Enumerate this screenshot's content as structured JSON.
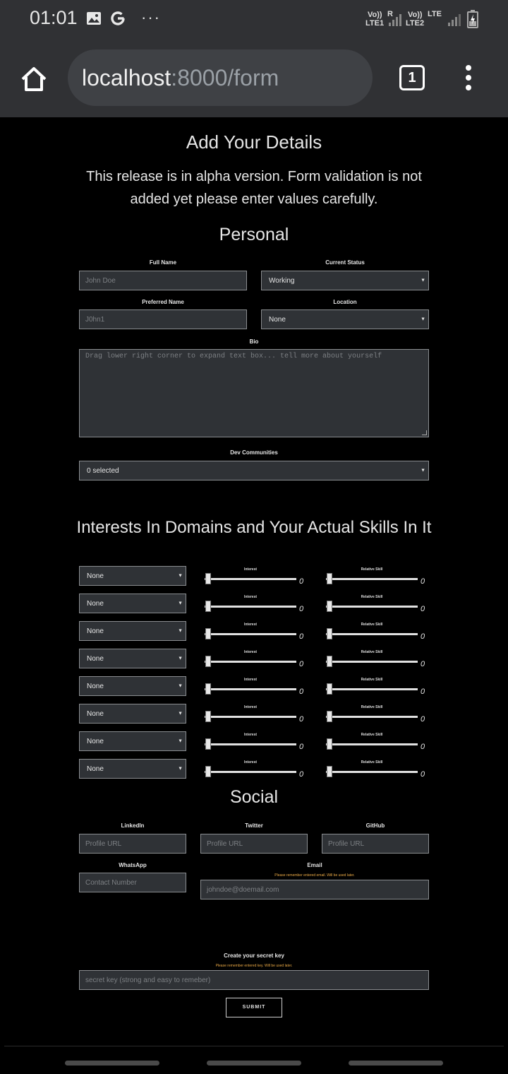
{
  "status_bar": {
    "time": "01:01",
    "icons": [
      "image-icon",
      "google-icon",
      "more-icon"
    ],
    "sim1": "LTE1",
    "sim2": "LTE2",
    "volte1": "Vo))",
    "volte2": "Vo))",
    "roaming": "R",
    "lte": "LTE"
  },
  "browser": {
    "url_host": "localhost",
    "url_path": ":8000/form",
    "tab_count": "1"
  },
  "page": {
    "title": "Add Your Details",
    "notice": "This release is in alpha version. Form validation is not added yet please enter values carefully."
  },
  "personal": {
    "heading": "Personal",
    "full_name_label": "Full Name",
    "full_name_placeholder": "John Doe",
    "current_status_label": "Current Status",
    "current_status_value": "Working",
    "preferred_name_label": "Preferred Name",
    "preferred_name_placeholder": "J0hn1",
    "location_label": "Location",
    "location_value": "None",
    "bio_label": "Bio",
    "bio_placeholder": "Drag lower right corner to expand text box... tell more about yourself",
    "dev_communities_label": "Dev Communities",
    "dev_communities_value": "0 selected"
  },
  "interests": {
    "heading": "Interests In Domains and Your Actual Skills In It",
    "interest_label": "Interest",
    "skill_label": "Relative Skill",
    "rows": [
      {
        "domain": "None",
        "interest": 0,
        "skill": 0
      },
      {
        "domain": "None",
        "interest": 0,
        "skill": 0
      },
      {
        "domain": "None",
        "interest": 0,
        "skill": 0
      },
      {
        "domain": "None",
        "interest": 0,
        "skill": 0
      },
      {
        "domain": "None",
        "interest": 0,
        "skill": 0
      },
      {
        "domain": "None",
        "interest": 0,
        "skill": 0
      },
      {
        "domain": "None",
        "interest": 0,
        "skill": 0
      },
      {
        "domain": "None",
        "interest": 0,
        "skill": 0
      }
    ]
  },
  "social": {
    "heading": "Social",
    "linkedin_label": "LinkedIn",
    "linkedin_placeholder": "Profile URL",
    "twitter_label": "Twitter",
    "twitter_placeholder": "Profile URL",
    "github_label": "GitHub",
    "github_placeholder": "Profile URL",
    "whatsapp_label": "WhatsApp",
    "whatsapp_placeholder": "Contact Number",
    "email_label": "Email",
    "email_warning": "Please remember entered email. Will be used later.",
    "email_placeholder": "johndoe@doemail.com"
  },
  "secret": {
    "label": "Create your secret key",
    "warning": "Please remember entered key. Will be used later.",
    "placeholder": "secret key (strong and easy to remeber)",
    "submit_label": "SUBMIT"
  },
  "colors": {
    "background": "#000000",
    "browser_chrome": "#303134",
    "input_bg": "#2f3236",
    "warning": "#e8a845"
  }
}
